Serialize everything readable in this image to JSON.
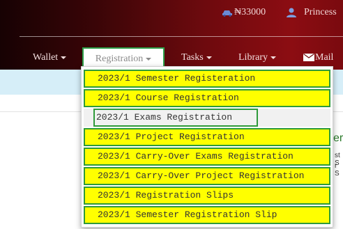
{
  "header": {
    "balance": "₦33000",
    "username": "Princess",
    "icons": {
      "balance": "car-icon",
      "user": "user-icon",
      "mail": "mail-icon"
    }
  },
  "nav": {
    "items": [
      {
        "label": "Wallet",
        "has_dropdown": true
      },
      {
        "label": "Registration",
        "has_dropdown": true,
        "active": true
      },
      {
        "label": "Tasks",
        "has_dropdown": true
      },
      {
        "label": "Library",
        "has_dropdown": true
      },
      {
        "label": "Mail",
        "has_dropdown": false
      }
    ]
  },
  "registration_menu": {
    "items": [
      {
        "label": "2023/1 Semester Registeration",
        "highlighted": true
      },
      {
        "label": "2023/1 Course Registration",
        "highlighted": true
      },
      {
        "label": "2023/1 Exams Registration",
        "highlighted": false,
        "selected": true
      },
      {
        "label": "2023/1 Project Registration",
        "highlighted": true
      },
      {
        "label": "2023/1 Carry-Over Exams Registration",
        "highlighted": true
      },
      {
        "label": "2023/1 Carry-Over Project Registration",
        "highlighted": true
      },
      {
        "label": "2023/1 Registration Slips",
        "highlighted": true
      },
      {
        "label": "2023/1 Semester Registration Slip",
        "highlighted": true
      }
    ]
  },
  "side_panel": {
    "heading": "er",
    "line1": "st S",
    "line2": "r S"
  },
  "colors": {
    "header_dark": "#170203",
    "header_red": "#8c0d12",
    "highlight_yellow": "#ffff00",
    "outline_green": "#2e9a3a",
    "info_strip": "#d6eef8"
  }
}
